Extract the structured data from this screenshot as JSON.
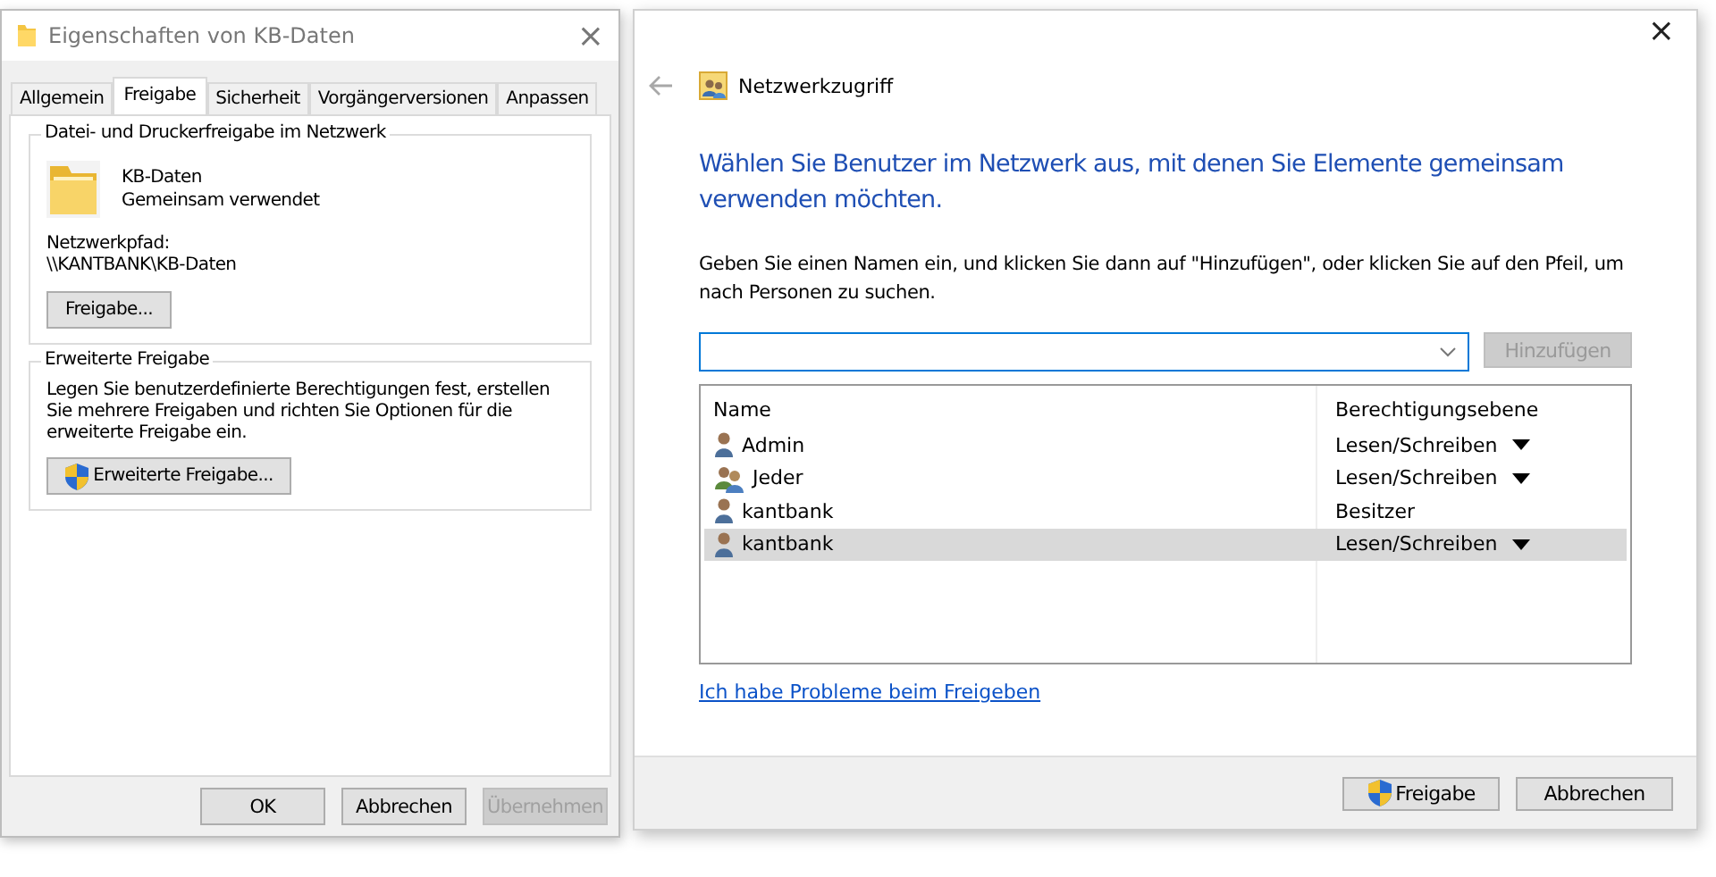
{
  "properties_dialog": {
    "title": "Eigenschaften von KB-Daten",
    "close": "×",
    "tabs": [
      {
        "label": "Allgemein",
        "selected": false
      },
      {
        "label": "Freigabe",
        "selected": true
      },
      {
        "label": "Sicherheit",
        "selected": false
      },
      {
        "label": "Vorgängerversionen",
        "selected": false
      },
      {
        "label": "Anpassen",
        "selected": false
      }
    ],
    "sharing_group": {
      "legend": "Datei- und Druckerfreigabe im Netzwerk",
      "folder_name": "KB-Daten",
      "folder_status": "Gemeinsam verwendet",
      "path_label": "Netzwerkpfad:",
      "path": "\\\\KANTBANK\\KB-Daten",
      "button": "Freigabe..."
    },
    "advanced_group": {
      "legend": "Erweiterte Freigabe",
      "description": "Legen Sie benutzerdefinierte Berechtigungen fest, erstellen Sie mehrere Freigaben und richten Sie Optionen für die erweiterte Freigabe ein.",
      "button": "Erweiterte Freigabe..."
    },
    "buttons": [
      {
        "label": "OK",
        "disabled": false
      },
      {
        "label": "Abbrechen",
        "disabled": false
      },
      {
        "label": "Übernehmen",
        "disabled": true
      }
    ]
  },
  "network_dialog": {
    "close": "×",
    "title": "Netzwerkzugriff",
    "heading": "Wählen Sie Benutzer im Netzwerk aus, mit denen Sie Elemente gemeinsam verwenden möchten.",
    "instruction": "Geben Sie einen Namen ein, und klicken Sie dann auf \"Hinzufügen\", oder klicken Sie auf den Pfeil, um nach Personen zu suchen.",
    "add_button": {
      "label": "Hinzufügen",
      "disabled": true
    },
    "table": {
      "columns": [
        "Name",
        "Berechtigungsebene"
      ],
      "rows": [
        {
          "name": "Admin",
          "kind": "user",
          "permission": "Lesen/Schreiben",
          "dropdown": true,
          "selected": false
        },
        {
          "name": "Jeder",
          "kind": "group",
          "permission": "Lesen/Schreiben",
          "dropdown": true,
          "selected": false
        },
        {
          "name": "kantbank",
          "kind": "user",
          "permission": "Besitzer",
          "dropdown": false,
          "selected": false
        },
        {
          "name": "kantbank",
          "kind": "user",
          "permission": "Lesen/Schreiben",
          "dropdown": true,
          "selected": true
        }
      ]
    },
    "help_link": "Ich habe Probleme beim Freigeben",
    "buttons": [
      {
        "label": "Freigabe",
        "shield": true
      },
      {
        "label": "Abbrechen",
        "shield": false
      }
    ]
  }
}
